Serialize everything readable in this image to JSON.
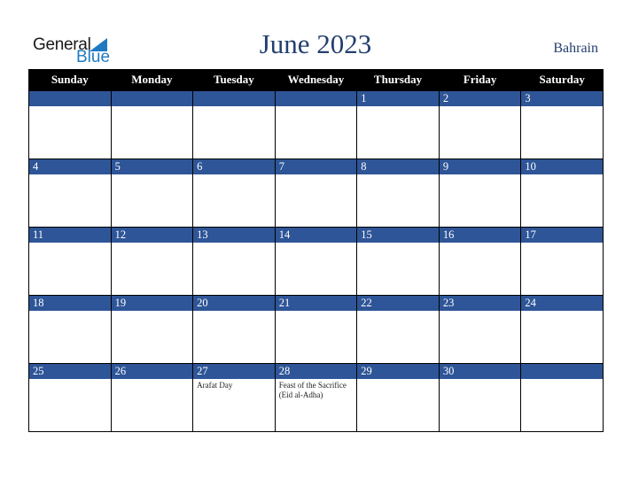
{
  "header": {
    "logo": {
      "general": "General",
      "blue": "Blue",
      "icon": "triangle-flag-icon"
    },
    "title": "June 2023",
    "country": "Bahrain"
  },
  "calendar": {
    "weekdays": [
      "Sunday",
      "Monday",
      "Tuesday",
      "Wednesday",
      "Thursday",
      "Friday",
      "Saturday"
    ],
    "weeks": [
      [
        {
          "day": "",
          "event": ""
        },
        {
          "day": "",
          "event": ""
        },
        {
          "day": "",
          "event": ""
        },
        {
          "day": "",
          "event": ""
        },
        {
          "day": "1",
          "event": ""
        },
        {
          "day": "2",
          "event": ""
        },
        {
          "day": "3",
          "event": ""
        }
      ],
      [
        {
          "day": "4",
          "event": ""
        },
        {
          "day": "5",
          "event": ""
        },
        {
          "day": "6",
          "event": ""
        },
        {
          "day": "7",
          "event": ""
        },
        {
          "day": "8",
          "event": ""
        },
        {
          "day": "9",
          "event": ""
        },
        {
          "day": "10",
          "event": ""
        }
      ],
      [
        {
          "day": "11",
          "event": ""
        },
        {
          "day": "12",
          "event": ""
        },
        {
          "day": "13",
          "event": ""
        },
        {
          "day": "14",
          "event": ""
        },
        {
          "day": "15",
          "event": ""
        },
        {
          "day": "16",
          "event": ""
        },
        {
          "day": "17",
          "event": ""
        }
      ],
      [
        {
          "day": "18",
          "event": ""
        },
        {
          "day": "19",
          "event": ""
        },
        {
          "day": "20",
          "event": ""
        },
        {
          "day": "21",
          "event": ""
        },
        {
          "day": "22",
          "event": ""
        },
        {
          "day": "23",
          "event": ""
        },
        {
          "day": "24",
          "event": ""
        }
      ],
      [
        {
          "day": "25",
          "event": ""
        },
        {
          "day": "26",
          "event": ""
        },
        {
          "day": "27",
          "event": "Arafat Day"
        },
        {
          "day": "28",
          "event": "Feast of the Sacrifice (Eid al-Adha)"
        },
        {
          "day": "29",
          "event": ""
        },
        {
          "day": "30",
          "event": ""
        },
        {
          "day": "",
          "event": ""
        }
      ]
    ]
  },
  "colors": {
    "header_bg": "#000000",
    "date_bar": "#2e5597",
    "title": "#233f6e",
    "logo_blue": "#1f7ac2"
  }
}
